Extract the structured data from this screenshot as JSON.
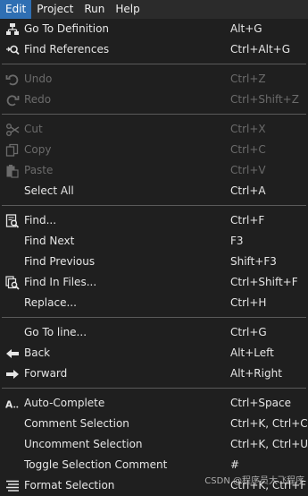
{
  "menubar": {
    "items": [
      {
        "label": "Edit"
      },
      {
        "label": "Project"
      },
      {
        "label": "Run"
      },
      {
        "label": "Help"
      }
    ]
  },
  "menu": {
    "items": [
      {
        "label": "Go To Definition",
        "shortcut": "Alt+G"
      },
      {
        "label": "Find References",
        "shortcut": "Ctrl+Alt+G"
      },
      {
        "label": "Undo",
        "shortcut": "Ctrl+Z"
      },
      {
        "label": "Redo",
        "shortcut": "Ctrl+Shift+Z"
      },
      {
        "label": "Cut",
        "shortcut": "Ctrl+X"
      },
      {
        "label": "Copy",
        "shortcut": "Ctrl+C"
      },
      {
        "label": "Paste",
        "shortcut": "Ctrl+V"
      },
      {
        "label": "Select All",
        "shortcut": "Ctrl+A"
      },
      {
        "label": "Find...",
        "shortcut": "Ctrl+F"
      },
      {
        "label": "Find Next",
        "shortcut": "F3"
      },
      {
        "label": "Find Previous",
        "shortcut": "Shift+F3"
      },
      {
        "label": "Find In Files...",
        "shortcut": "Ctrl+Shift+F"
      },
      {
        "label": "Replace...",
        "shortcut": "Ctrl+H"
      },
      {
        "label": "Go To line...",
        "shortcut": "Ctrl+G"
      },
      {
        "label": "Back",
        "shortcut": "Alt+Left"
      },
      {
        "label": "Forward",
        "shortcut": "Alt+Right"
      },
      {
        "label": "Auto-Complete",
        "shortcut": "Ctrl+Space"
      },
      {
        "label": "Comment Selection",
        "shortcut": "Ctrl+K, Ctrl+C"
      },
      {
        "label": "Uncomment Selection",
        "shortcut": "Ctrl+K, Ctrl+U"
      },
      {
        "label": "Toggle Selection Comment",
        "shortcut": "#"
      },
      {
        "label": "Format Selection",
        "shortcut": "Ctrl+K, Ctrl+F"
      }
    ]
  },
  "watermark": "CSDN @程序员大飞程序",
  "colors": {
    "accent": "#2f6fb3",
    "menu_bg": "#1f1f1f",
    "disabled_text": "#6b6b6b"
  }
}
